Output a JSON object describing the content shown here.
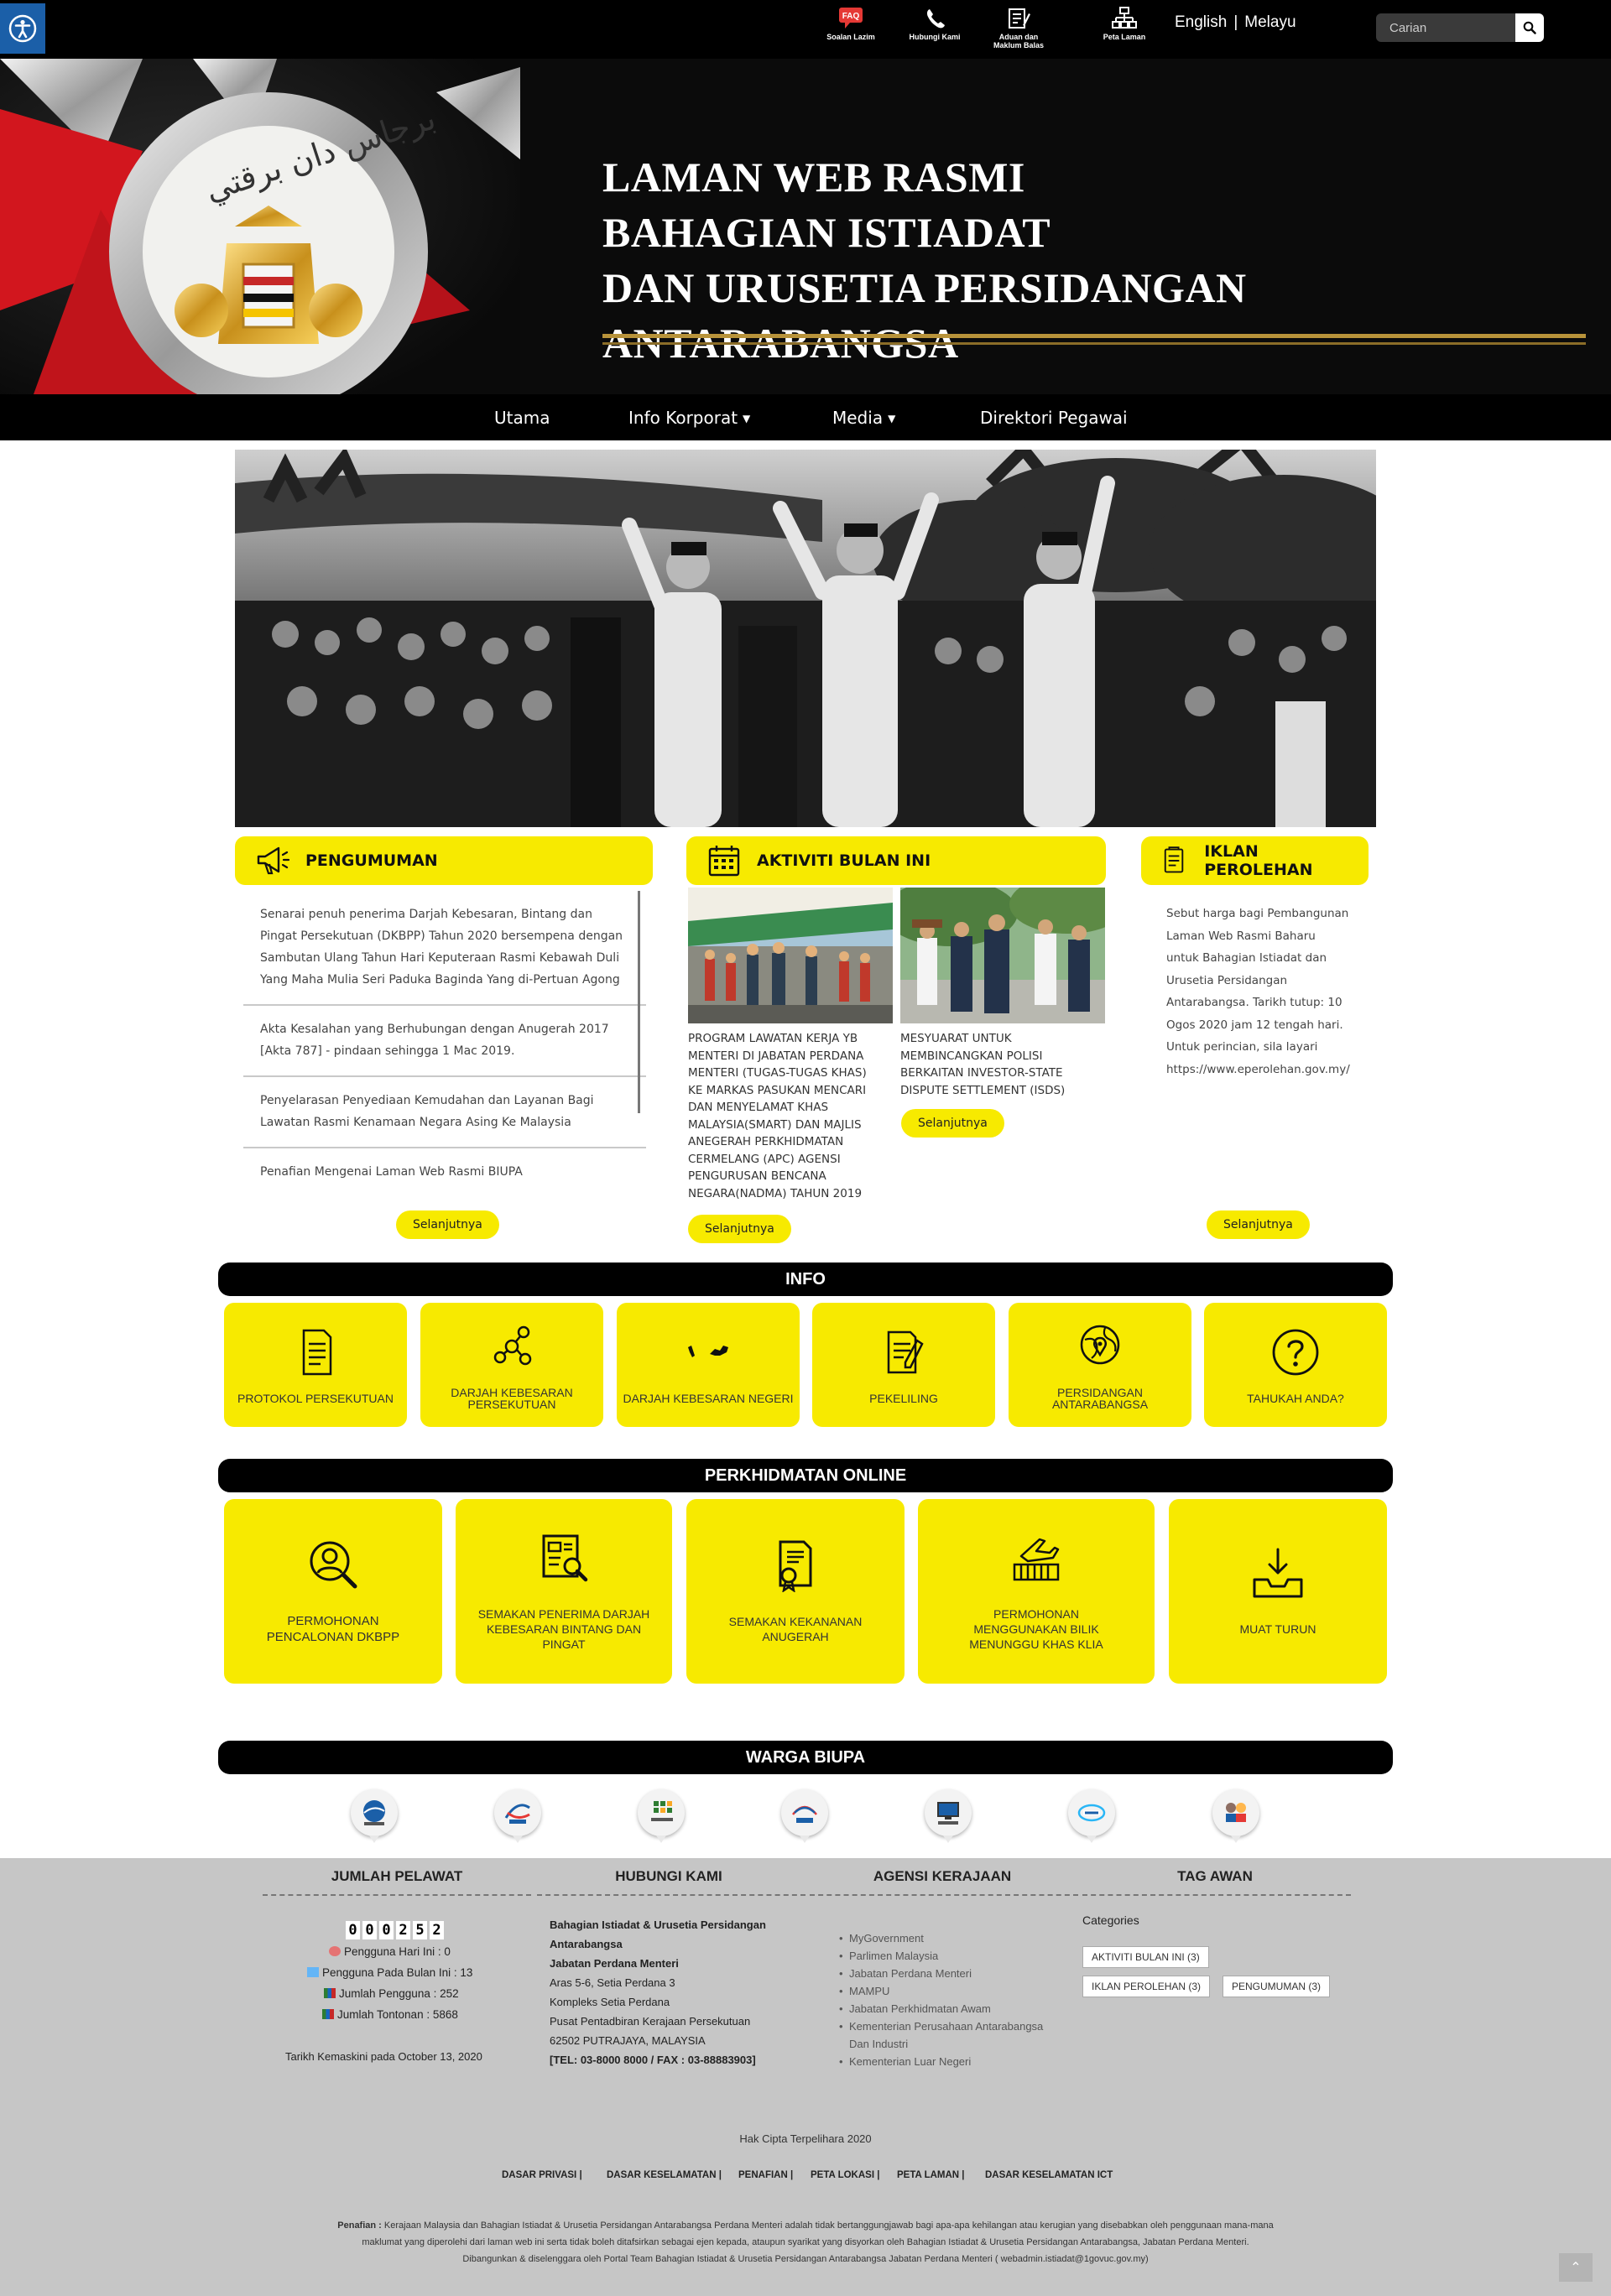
{
  "topbar": {
    "quick_links": [
      {
        "label": "Soalan Lazim",
        "icon": "faq-icon"
      },
      {
        "label": "Hubungi Kami",
        "icon": "phone-icon"
      },
      {
        "label": "Aduan dan Maklum Balas",
        "icon": "feedback-icon"
      },
      {
        "label": "Peta Laman",
        "icon": "sitemap-icon"
      }
    ],
    "faq_badge": "FAQ",
    "lang_en": "English",
    "lang_sep": "|",
    "lang_ms": "Melayu",
    "search_placeholder": "Carian"
  },
  "banner": {
    "line1": "LAMAN WEB RASMI",
    "line2": "BAHAGIAN ISTIADAT",
    "line3": "DAN URUSETIA PERSIDANGAN ANTARABANGSA"
  },
  "nav": {
    "items": [
      {
        "label": "Utama"
      },
      {
        "label": "Info Korporat"
      },
      {
        "label": "Media"
      },
      {
        "label": "Direktori Pegawai"
      }
    ]
  },
  "pengumuman": {
    "title": "PENGUMUMAN",
    "items": [
      "Senarai penuh penerima Darjah Kebesaran, Bintang dan Pingat Persekutuan (DKBPP) Tahun 2020 bersempena dengan Sambutan Ulang Tahun Hari Keputeraan Rasmi Kebawah Duli Yang Maha Mulia Seri Paduka Baginda Yang di-Pertuan Agong",
      "Akta Kesalahan yang Berhubungan dengan Anugerah 2017 [Akta 787] - pindaan sehingga 1 Mac 2019.",
      "Penyelarasan Penyediaan Kemudahan dan Layanan Bagi Lawatan Rasmi Kenamaan Negara Asing Ke Malaysia",
      "Penafian Mengenai Laman Web Rasmi BIUPA"
    ],
    "more": "Selanjutnya"
  },
  "aktiviti": {
    "title": "AKTIVITI BULAN INI",
    "items": [
      {
        "caption": "PROGRAM LAWATAN KERJA YB MENTERI DI JABATAN PERDANA MENTERI (Tugas-Tugas Khas) KE MARKAS PASUKAN MENCARI DAN MENYELAMAT KHAS MALAYSIA(SMART) DAN MAJLIS ANEGERAH PERKHIDMATAN CERMELANG (APC) AGENSI PENGURUSAN BENCANA NEGARA(NADMA) TAHUN 2019",
        "more": "Selanjutnya"
      },
      {
        "caption": "MESYUARAT UNTUK MEMBINCANGKAN POLISI BERKAITAN INVESTOR-STATE DISPUTE SETTLEMENT (ISDS)",
        "more": "Selanjutnya"
      }
    ]
  },
  "iklan": {
    "title": "IKLAN PEROLEHAN",
    "text": "Sebut harga bagi Pembangunan Laman Web Rasmi Baharu untuk Bahagian Istiadat dan Urusetia Persidangan Antarabangsa. Tarikh tutup: 10 Ogos 2020 jam 12 tengah hari. Untuk perincian, sila layari https://www.eperolehan.gov.my/",
    "more": "Selanjutnya"
  },
  "info": {
    "title": "INFO",
    "tiles": [
      {
        "label": "PROTOKOL PERSEKUTUAN",
        "icon": "document-icon"
      },
      {
        "label": "DARJAH KEBESARAN PERSEKUTUAN",
        "icon": "network-icon"
      },
      {
        "label": "DARJAH KEBESARAN NEGERI",
        "icon": "malaysia-map-icon"
      },
      {
        "label": "PEKELILING",
        "icon": "circular-document-icon"
      },
      {
        "label": "PERSIDANGAN ANTARABANGSA",
        "icon": "globe-pin-icon"
      },
      {
        "label": "TAHUKAH ANDA?",
        "icon": "question-icon"
      }
    ]
  },
  "online": {
    "title": "PERKHIDMATAN ONLINE",
    "tiles": [
      {
        "label": "PERMOHONAN PENCALONAN DKBPP",
        "icon": "user-search-icon"
      },
      {
        "label": "SEMAKAN PENERIMA DARJAH KEBESARAN BINTANG DAN PINGAT",
        "icon": "report-search-icon"
      },
      {
        "label": "SEMAKAN KEKANANAN ANUGERAH",
        "icon": "certificate-icon"
      },
      {
        "label": "PERMOHONAN MENGGUNAKAN BILIK MENUNGGU KHAS KLIA",
        "icon": "airport-icon"
      },
      {
        "label": "MUAT TURUN",
        "icon": "download-tray-icon"
      }
    ]
  },
  "warga": {
    "title": "WARGA BIUPA",
    "logos": [
      "webmail-logo",
      "hrmis-logo",
      "ecentral-logo",
      "eperolehan-logo",
      "portal-logo",
      "aset-logo",
      "sistem-logo"
    ]
  },
  "footer": {
    "pelawat": {
      "title": "JUMLAH PELAWAT",
      "counter": [
        "0",
        "0",
        "0",
        "2",
        "5",
        "2"
      ],
      "today": "Pengguna Hari Ini : 0",
      "month": "Pengguna Pada Bulan Ini : 13",
      "total_users": "Jumlah Pengguna : 252",
      "total_views": "Jumlah Tontonan : 5868",
      "updated": "Tarikh Kemaskini pada October 13, 2020"
    },
    "hubungi": {
      "title": "HUBUNGI KAMI",
      "org1": "Bahagian Istiadat & Urusetia Persidangan",
      "org2": "Antarabangsa",
      "dept": "Jabatan Perdana Menteri",
      "addr1": "Aras 5-6, Setia Perdana 3",
      "addr2": "Kompleks Setia Perdana",
      "addr3": "Pusat Pentadbiran Kerajaan Persekutuan",
      "addr4": "62502 PUTRAJAYA, MALAYSIA",
      "phone": "[TEL: 03-8000 8000 / FAX : 03-88883903]"
    },
    "agensi": {
      "title": "AGENSI KERAJAAN",
      "items": [
        "MyGovernment",
        "Parlimen Malaysia",
        "Jabatan Perdana Menteri",
        "MAMPU",
        "Jabatan Perkhidmatan Awam",
        "Kementerian Perusahaan Antarabangsa Dan Industri",
        "Kementerian Luar Negeri"
      ]
    },
    "tag": {
      "title": "TAG AWAN",
      "categories_label": "Categories",
      "tags": [
        "AKTIVITI BULAN INI (3)",
        "IKLAN PEROLEHAN (3)",
        "PENGUMUMAN (3)"
      ]
    },
    "copyright": "Hak Cipta Terpelihara 2020",
    "links": [
      "DASAR PRIVASI |",
      "DASAR KESELAMATAN |",
      "PENAFIAN |",
      "PETA LOKASI |",
      "PETA LAMAN |",
      "DASAR KESELAMATAN ICT"
    ],
    "disclaimer_label": "Penafian :",
    "disclaimer_1": "Kerajaan Malaysia dan Bahagian Istiadat & Urusetia Persidangan Antarabangsa Perdana Menteri adalah tidak bertanggungjawab bagi apa-apa kehilangan atau kerugian yang disebabkan oleh penggunaan mana-mana",
    "disclaimer_2": "maklumat yang diperolehi dari laman web ini serta tidak boleh ditafsirkan sebagai ejen kepada, ataupun syarikat yang disyorkan oleh Bahagian Istiadat & Urusetia Persidangan Antarabangsa, Jabatan Perdana Menteri.",
    "disclaimer_3": "Dibangunkan & diselenggara oleh Portal Team Bahagian Istiadat & Urusetia Persidangan Antarabangsa Jabatan Perdana Menteri ( webadmin.istiadat@1govuc.gov.my)"
  },
  "colors": {
    "accent_yellow": "#f7ea00",
    "bar_black": "#000000",
    "footer_gray": "#c6c6c6",
    "access_blue": "#1b5fa8"
  }
}
